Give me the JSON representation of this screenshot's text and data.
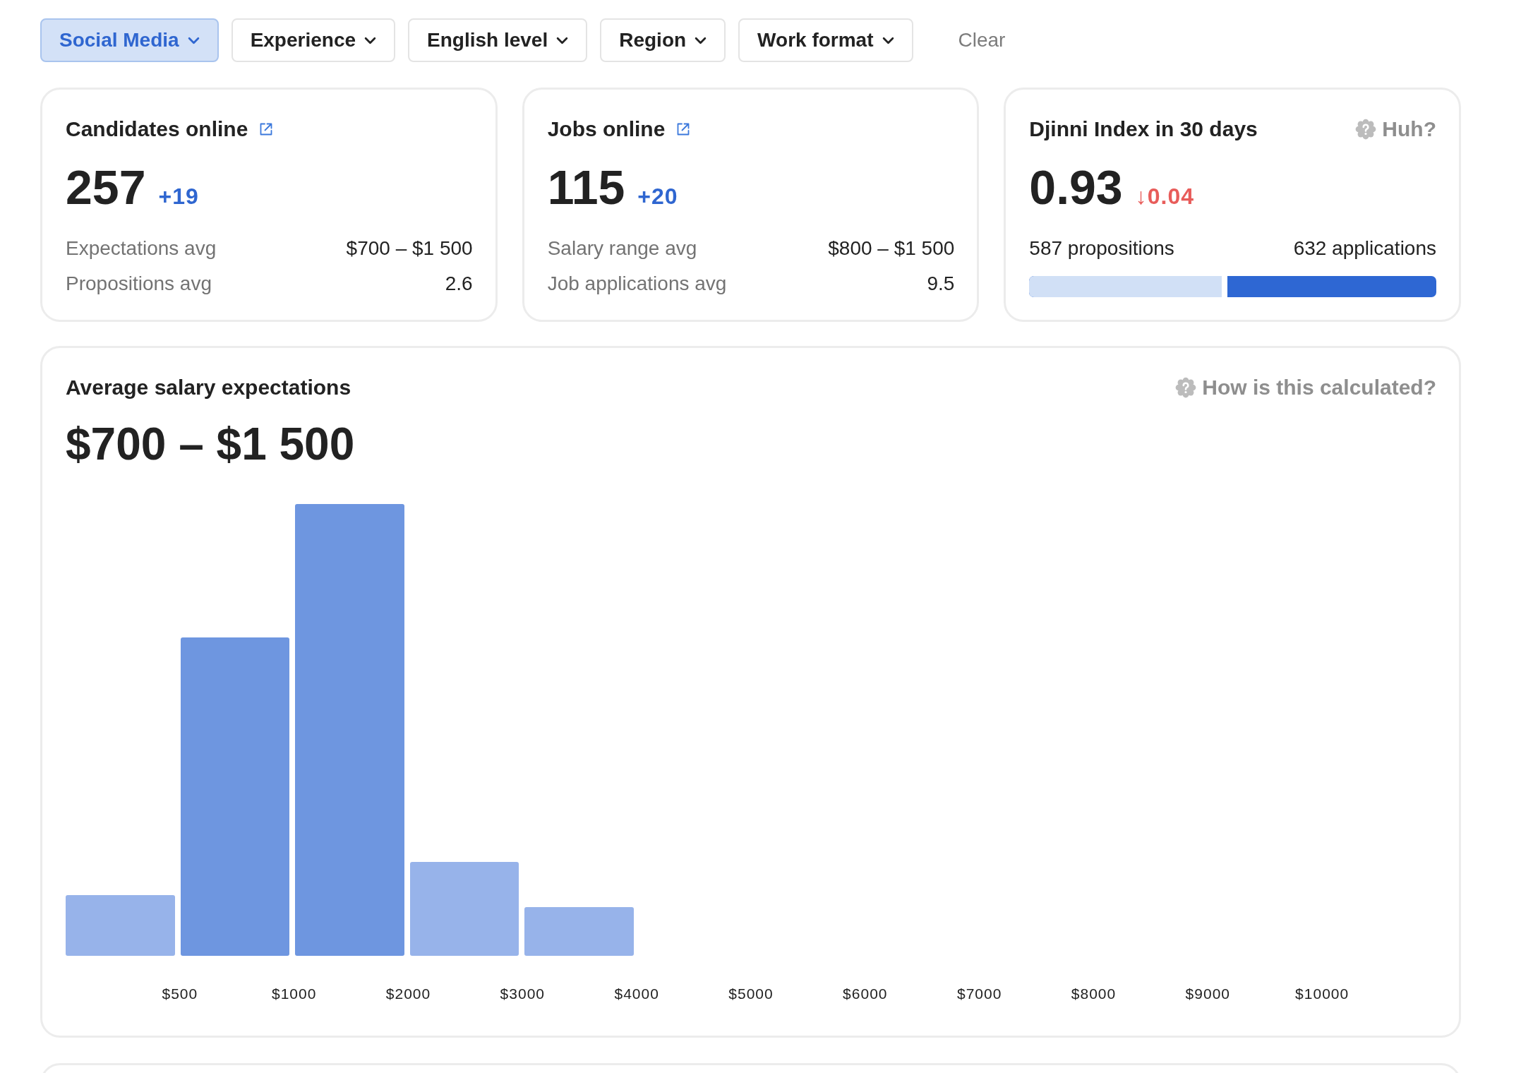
{
  "filters": [
    {
      "label": "Social Media",
      "selected": true
    },
    {
      "label": "Experience",
      "selected": false
    },
    {
      "label": "English level",
      "selected": false
    },
    {
      "label": "Region",
      "selected": false
    },
    {
      "label": "Work format",
      "selected": false
    }
  ],
  "clear_button": {
    "label": "Clear"
  },
  "stat_cards": [
    {
      "kind": "stats",
      "title": "Candidates online",
      "value": "257",
      "delta": "+19",
      "rising": true,
      "rows": [
        {
          "label": "Expectations avg",
          "value": "$700 – $1 500"
        },
        {
          "label": "Propositions avg",
          "value": "2.6"
        }
      ]
    },
    {
      "kind": "stats",
      "title": "Jobs online",
      "value": "115",
      "delta": "+20",
      "rising": true,
      "rows": [
        {
          "label": "Salary range avg",
          "value": "$800 – $1 500"
        },
        {
          "label": "Job applications avg",
          "value": "9.5"
        }
      ]
    },
    {
      "kind": "index",
      "title": "Djinni Index in 30 days",
      "help": "Huh?",
      "value": "0.93",
      "delta": "↓0.04",
      "rising": false,
      "left_label": "587 propositions",
      "right_label": "632 applications",
      "level": 0.48
    }
  ],
  "salary_chart": {
    "title": "Average salary expectations",
    "help": "How is this calculated?",
    "value": "$700 – $1 500",
    "bars": [
      {
        "highlighted": false
      },
      {
        "highlighted": true
      },
      {
        "highlighted": true
      },
      {
        "highlighted": false
      },
      {
        "highlighted": false
      }
    ],
    "x_labels": [
      "$500",
      "$1000",
      "$2000",
      "$3000",
      "$4000",
      "$5000",
      "$6000",
      "$7000",
      "$8000",
      "$9000",
      "$10000"
    ]
  }
}
